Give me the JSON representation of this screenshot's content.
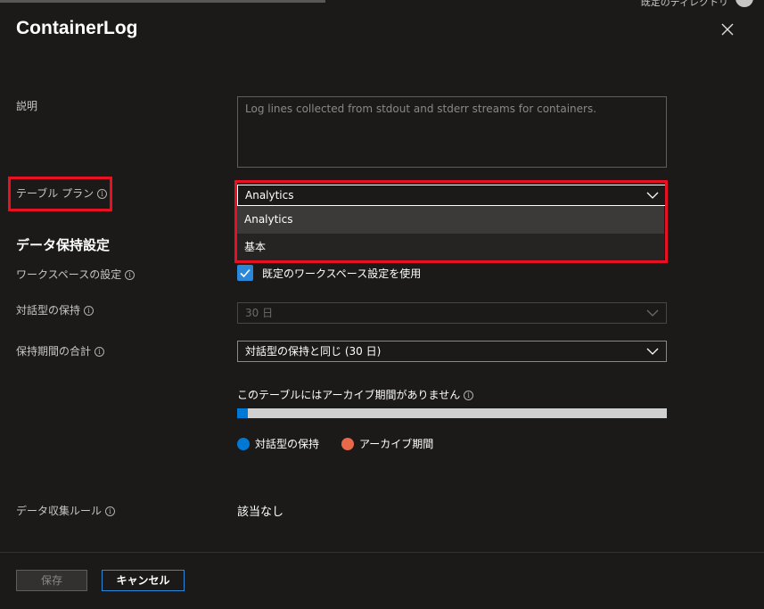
{
  "header": {
    "user_text": "既定のディレクトリ"
  },
  "panel": {
    "title": "ContainerLog"
  },
  "description": {
    "label": "説明",
    "placeholder": "Log lines collected from stdout and stderr streams for containers."
  },
  "table_plan": {
    "label": "テーブル プラン",
    "selected": "Analytics",
    "options": [
      "Analytics",
      "基本"
    ]
  },
  "retention": {
    "section_title": "データ保持設定",
    "workspace_label": "ワークスペースの設定",
    "workspace_checkbox_label": "既定のワークスペース設定を使用",
    "workspace_checked": true,
    "interactive_label": "対話型の保持",
    "interactive_value": "30 日",
    "total_label": "保持期間の合計",
    "total_value": "対話型の保持と同じ (30 日)",
    "archive_title": "このテーブルにはアーカイブ期間がありません",
    "interactive_fraction": 0.025,
    "legend_interactive": "対話型の保持",
    "legend_archive": "アーカイブ期間",
    "color_interactive": "#0078d4",
    "color_archive": "#e8694a"
  },
  "dcr": {
    "label": "データ収集ルール",
    "value": "該当なし"
  },
  "footer": {
    "save_label": "保存",
    "cancel_label": "キャンセル"
  }
}
